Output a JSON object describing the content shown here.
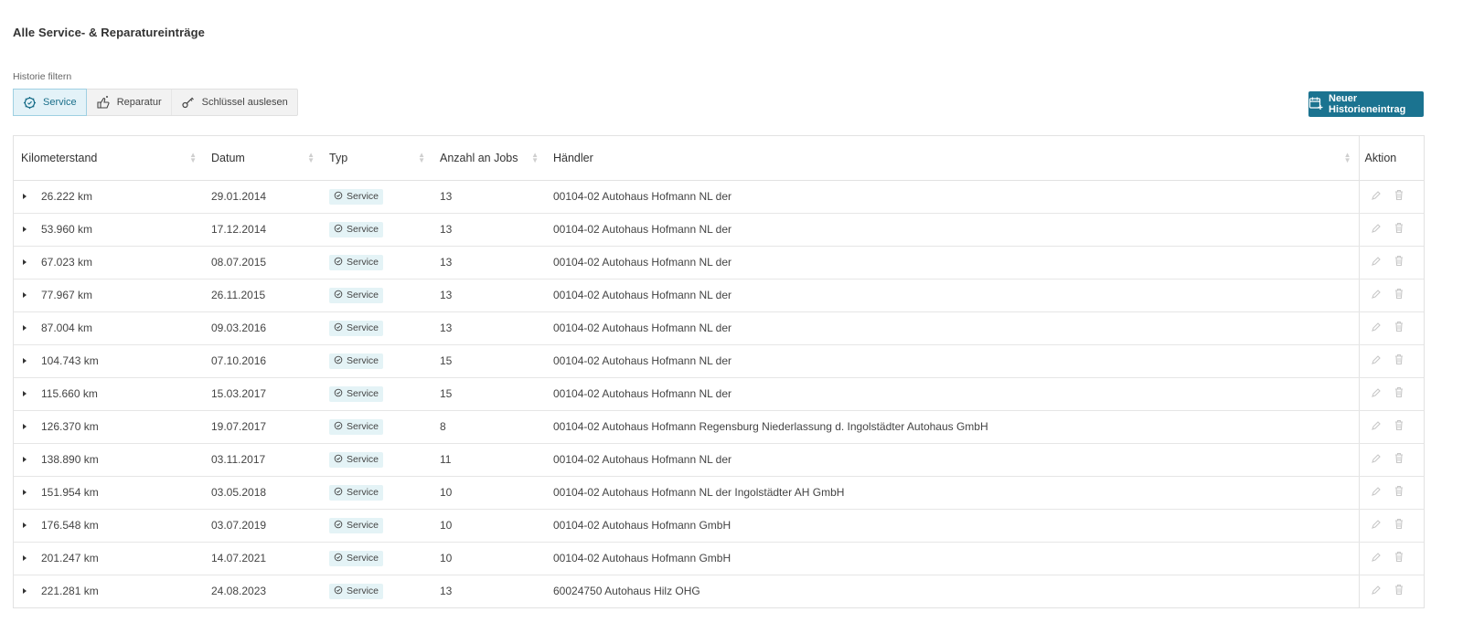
{
  "page": {
    "title": "Alle Service- & Reparatureinträge",
    "filter_label": "Historie filtern",
    "filters": [
      {
        "label": "Service",
        "icon": "service-gear-icon",
        "active": true
      },
      {
        "label": "Reparatur",
        "icon": "repair-hand-icon",
        "active": false
      },
      {
        "label": "Schlüssel auslesen",
        "icon": "key-icon",
        "active": false
      }
    ],
    "new_entry_button": "Neuer Historieneintrag"
  },
  "table": {
    "headers": {
      "km": "Kilometerstand",
      "date": "Datum",
      "type": "Typ",
      "jobs": "Anzahl an Jobs",
      "dealer": "Händler",
      "action": "Aktion"
    },
    "rows": [
      {
        "km": "26.222 km",
        "date": "29.01.2014",
        "type": "Service",
        "jobs": "13",
        "dealer": "00104-02 Autohaus Hofmann NL der"
      },
      {
        "km": "53.960 km",
        "date": "17.12.2014",
        "type": "Service",
        "jobs": "13",
        "dealer": "00104-02 Autohaus Hofmann NL der"
      },
      {
        "km": "67.023 km",
        "date": "08.07.2015",
        "type": "Service",
        "jobs": "13",
        "dealer": "00104-02 Autohaus Hofmann NL der"
      },
      {
        "km": "77.967 km",
        "date": "26.11.2015",
        "type": "Service",
        "jobs": "13",
        "dealer": "00104-02 Autohaus Hofmann NL der"
      },
      {
        "km": "87.004 km",
        "date": "09.03.2016",
        "type": "Service",
        "jobs": "13",
        "dealer": "00104-02 Autohaus Hofmann NL der"
      },
      {
        "km": "104.743 km",
        "date": "07.10.2016",
        "type": "Service",
        "jobs": "15",
        "dealer": "00104-02 Autohaus Hofmann NL der"
      },
      {
        "km": "115.660 km",
        "date": "15.03.2017",
        "type": "Service",
        "jobs": "15",
        "dealer": "00104-02 Autohaus Hofmann NL der"
      },
      {
        "km": "126.370 km",
        "date": "19.07.2017",
        "type": "Service",
        "jobs": "8",
        "dealer": "00104-02 Autohaus Hofmann Regensburg Niederlassung d. Ingolstädter Autohaus GmbH"
      },
      {
        "km": "138.890 km",
        "date": "03.11.2017",
        "type": "Service",
        "jobs": "11",
        "dealer": "00104-02 Autohaus Hofmann NL der"
      },
      {
        "km": "151.954 km",
        "date": "03.05.2018",
        "type": "Service",
        "jobs": "10",
        "dealer": "00104-02 Autohaus Hofmann NL der Ingolstädter AH GmbH"
      },
      {
        "km": "176.548 km",
        "date": "03.07.2019",
        "type": "Service",
        "jobs": "10",
        "dealer": "00104-02 Autohaus Hofmann GmbH"
      },
      {
        "km": "201.247 km",
        "date": "14.07.2021",
        "type": "Service",
        "jobs": "10",
        "dealer": "00104-02 Autohaus Hofmann GmbH"
      },
      {
        "km": "221.281 km",
        "date": "24.08.2023",
        "type": "Service",
        "jobs": "13",
        "dealer": "60024750 Autohaus Hilz OHG"
      }
    ]
  },
  "colors": {
    "accent": "#1b7390",
    "badge_bg": "#e4f3f6",
    "active_filter_bg": "#e3f2f8"
  }
}
